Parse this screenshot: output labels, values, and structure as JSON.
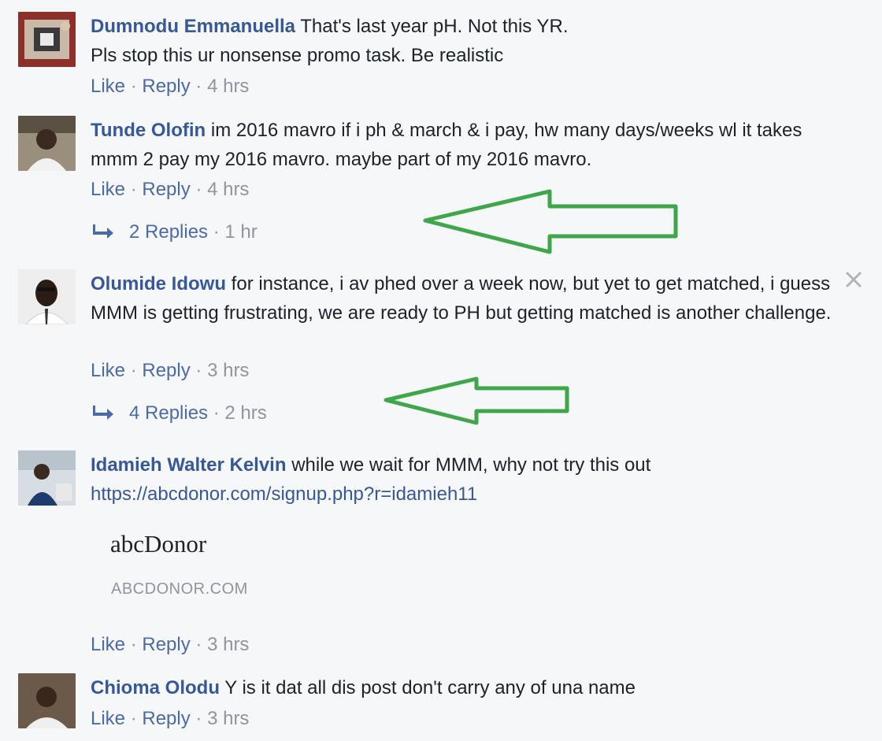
{
  "comments": [
    {
      "author": "Dumnodu Emmanuella",
      "text": "That's last year pH. Not this YR.",
      "text_line2": "Pls stop this ur nonsense promo task. Be realistic",
      "like": "Like",
      "reply": "Reply",
      "time": "4 hrs"
    },
    {
      "author": "Tunde Olofin",
      "text": "im 2016 mavro if i ph & march & i pay, hw many days/weeks wl it takes mmm 2 pay my 2016 mavro. maybe part of my 2016 mavro.",
      "like": "Like",
      "reply": "Reply",
      "time": "4 hrs",
      "replies_label": "2 Replies",
      "replies_time": "1 hr"
    },
    {
      "author": "Olumide Idowu",
      "text": "for instance, i av phed over a week now, but yet to get matched, i guess MMM is getting frustrating, we are ready to PH but getting matched is another challenge.",
      "like": "Like",
      "reply": "Reply",
      "time": "3 hrs",
      "replies_label": "4 Replies",
      "replies_time": "2 hrs"
    },
    {
      "author": "Idamieh Walter Kelvin",
      "text": "while we wait for MMM, why not try this out",
      "link": "https://abcdonor.com/signup.php?r=idamieh11",
      "preview_title": "abcDonor",
      "preview_domain": "ABCDONOR.COM",
      "like": "Like",
      "reply": "Reply",
      "time": "3 hrs"
    },
    {
      "author": "Chioma Olodu",
      "text": "Y is it dat all dis post don't carry any of una name",
      "like": "Like",
      "reply": "Reply",
      "time": "3 hrs"
    }
  ],
  "separator": "·",
  "icons": {
    "close": "close-icon",
    "reply_arrow": "reply-arrow-icon",
    "annotation_arrow": "green-arrow-annotation"
  },
  "colors": {
    "author": "#365899",
    "meta": "#90949c",
    "annotation": "#3fa64a",
    "background": "#f6f7f9"
  }
}
